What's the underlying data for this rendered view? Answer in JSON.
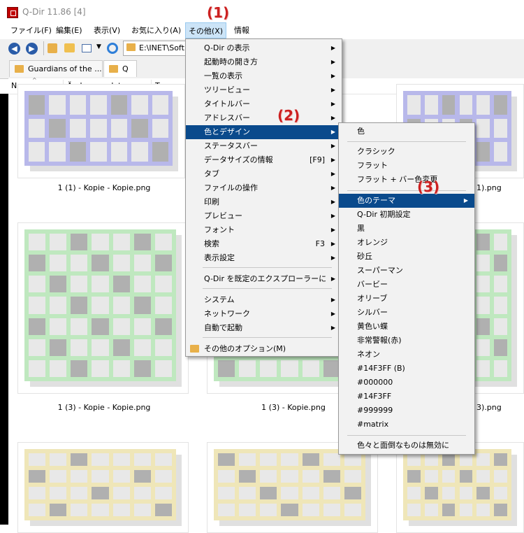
{
  "window": {
    "title": "Q-Dir 11.86 [4]"
  },
  "annotations": {
    "step1": "(1)",
    "step2": "(2)",
    "step3": "(3)"
  },
  "menubar": [
    {
      "label": "ファイル(F)"
    },
    {
      "label": "編集(E)"
    },
    {
      "label": "表示(V)"
    },
    {
      "label": "お気に入り(A)"
    },
    {
      "label": "その他(X)"
    },
    {
      "label": "情報"
    }
  ],
  "toolbar": {
    "address": "E:\\INET\\Soft"
  },
  "tabs": [
    {
      "label": "Guardians of the ..."
    },
    {
      "label": "Q"
    }
  ],
  "columns": [
    {
      "label": "Name"
    },
    {
      "label": "Änderungsdatum"
    },
    {
      "label": "Typ"
    }
  ],
  "files": [
    {
      "label": "1 (1) - Kopie - Kopie.png"
    },
    {
      "label": "1).png"
    },
    {
      "label": "1 (3) - Kopie - Kopie.png"
    },
    {
      "label": "1 (3) - Kopie.png"
    },
    {
      "label": "3).png"
    }
  ],
  "menu_sonota": {
    "items": [
      {
        "label": "Q-Dir の表示",
        "arrow": "▶"
      },
      {
        "label": "起動時の開き方",
        "arrow": "▶"
      },
      {
        "label": "一覧の表示",
        "arrow": "▶"
      },
      {
        "label": "ツリービュー",
        "arrow": "▶"
      },
      {
        "label": "タイトルバー",
        "arrow": "▶"
      },
      {
        "label": "アドレスバー",
        "arrow": "▶"
      },
      {
        "label": "色とデザイン",
        "arrow": "▶"
      },
      {
        "label": "ステータスバー",
        "arrow": "▶"
      },
      {
        "label": "データサイズの情報",
        "shortcut": "[F9]",
        "arrow": "▶"
      },
      {
        "label": "タブ",
        "arrow": "▶"
      },
      {
        "label": "ファイルの操作",
        "arrow": "▶"
      },
      {
        "label": "印刷",
        "arrow": "▶"
      },
      {
        "label": "プレビュー",
        "arrow": "▶"
      },
      {
        "label": "フォント",
        "arrow": "▶"
      },
      {
        "label": "検索",
        "shortcut": "F3",
        "arrow": "▶"
      },
      {
        "label": "表示設定",
        "arrow": "▶"
      },
      {
        "label": "Q-Dir を既定のエクスプローラーに",
        "arrow": "▶"
      },
      {
        "label": "システム",
        "arrow": "▶"
      },
      {
        "label": "ネットワーク",
        "arrow": "▶"
      },
      {
        "label": "自動で起動",
        "arrow": "▶"
      },
      {
        "label": "その他のオプション(M)"
      }
    ]
  },
  "menu_color": {
    "items": [
      {
        "label": "色"
      },
      {
        "label": "クラシック"
      },
      {
        "label": "フラット"
      },
      {
        "label": "フラット + バー色変更"
      },
      {
        "label": "色のテーマ",
        "arrow": "▶"
      },
      {
        "label": "Q-Dir 初期設定"
      },
      {
        "label": "黒"
      },
      {
        "label": "オレンジ"
      },
      {
        "label": "砂丘"
      },
      {
        "label": "スーパーマン"
      },
      {
        "label": "バービー"
      },
      {
        "label": "オリーブ"
      },
      {
        "label": "シルバー"
      },
      {
        "label": "黄色い蝶"
      },
      {
        "label": "非常警報(赤)"
      },
      {
        "label": "ネオン"
      },
      {
        "label": "#14F3FF (B)"
      },
      {
        "label": "#000000"
      },
      {
        "label": "#14F3FF"
      },
      {
        "label": "#999999"
      },
      {
        "label": "#matrix"
      },
      {
        "label": "色々と面倒なものは無効に"
      }
    ]
  },
  "colors": {
    "highlight": "#0a4a8c",
    "hover": "#cce4f7",
    "thumb_blue": "#b8b8ea",
    "thumb_green": "#bfe8bf",
    "thumb_yellow": "#efe6b8",
    "cell_light": "#e8e8e8",
    "cell_dark": "#b0b0b0",
    "annotation": "#cc2020"
  }
}
